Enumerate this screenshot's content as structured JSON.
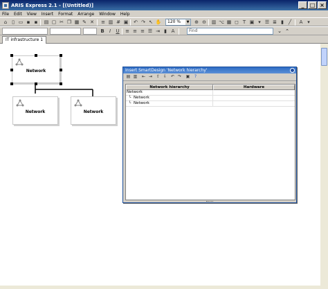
{
  "window": {
    "title": "ARIS Express 2.1 - [(Untitled)]",
    "minimize": "_",
    "maximize": "□",
    "close": "×"
  },
  "menu": [
    "File",
    "Edit",
    "View",
    "Insert",
    "Format",
    "Arrange",
    "Window",
    "Help"
  ],
  "toolbar": {
    "zoom": "120 %",
    "find_placeholder": "Find"
  },
  "tab": {
    "label": "IT infrastructure 1"
  },
  "diagram": {
    "nodes": [
      {
        "label": "Network",
        "selected": true
      },
      {
        "label": "Network"
      },
      {
        "label": "Network"
      }
    ]
  },
  "dialog": {
    "title": "Insert SmartDesign 'Network hierarchy'",
    "columns": [
      "Network hierarchy",
      "Hardware"
    ],
    "rows": [
      {
        "name": "Network",
        "level": 0
      },
      {
        "name": "Network",
        "level": 1
      },
      {
        "name": "Network",
        "level": 1
      }
    ]
  },
  "colors": {
    "title_bar": "#0a246a",
    "dialog_title": "#2e6cc4",
    "canvas": "#ffffff",
    "chrome": "#d4d0c8"
  }
}
